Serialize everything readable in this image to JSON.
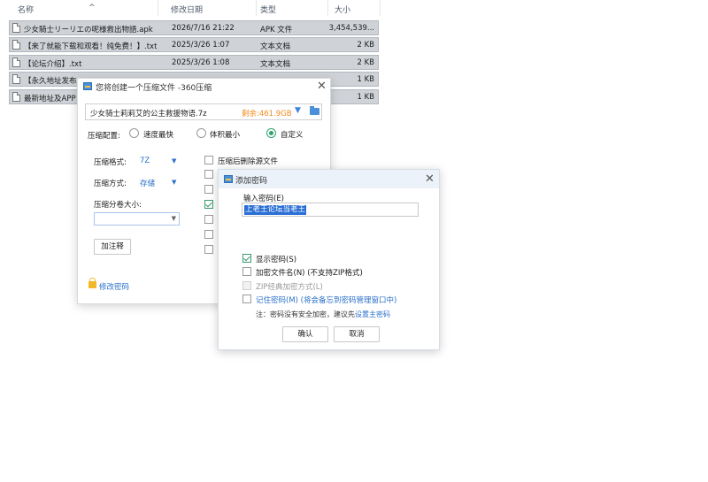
{
  "explorer": {
    "columns": {
      "name": "名称",
      "date": "修改日期",
      "type": "类型",
      "size": "大小"
    },
    "rows": [
      {
        "name": "少女騎士リーリエの呢様救出物語.apk",
        "date": "2026/7/16 21:22",
        "type": "APK 文件",
        "size": "3,454,539..."
      },
      {
        "name": "【来了就能下载和观看！纯免费！】.txt",
        "date": "2025/3/26 1:07",
        "type": "文本文档",
        "size": "2 KB"
      },
      {
        "name": "【论坛介绍】.txt",
        "date": "2025/3/26 1:08",
        "type": "文本文档",
        "size": "2 KB"
      },
      {
        "name": "【永久地址发布",
        "date": "",
        "type": "",
        "size": "1 KB"
      },
      {
        "name": "最新地址及APP",
        "date": "",
        "type": "",
        "size": "1 KB"
      }
    ]
  },
  "compress_dialog": {
    "title": "您将创建一个压缩文件 -360压缩",
    "close": "✕",
    "path": "少女骑士莉莉艾的公主救援物语.7z",
    "free_space": "剩余:461.9GB",
    "config_label": "压缩配置:",
    "radio_options": [
      "速度最快",
      "体积最小",
      "自定义"
    ],
    "format_label": "压缩格式:",
    "format_value": "7Z",
    "method_label": "压缩方式:",
    "method_value": "存储",
    "split_label": "压缩分卷大小:",
    "add_comment": "加注释",
    "delete_after": "压缩后删除源文件",
    "modify_password": "修改密码"
  },
  "password_dialog": {
    "title": "添加密码",
    "close": "✕",
    "input_label": "输入密码(E)",
    "password_value": "上老王论坛当老王",
    "show_password": "显示密码(S)",
    "encrypt_names": "加密文件名(N) (不支持ZIP格式)",
    "zip_classic": "ZIP经典加密方式(L)",
    "remember_password": "记住密码(M) (将会备忘到密码管理窗口中)",
    "note_text": "注：密码没有安全加密，建议先",
    "note_link": "设置主密码",
    "ok": "确认",
    "cancel": "取消"
  },
  "colors": {
    "accent": "#2a6fc9",
    "free_space": "#f28a1c",
    "selection": "#2b6fd6",
    "check_green": "#3a9a6e"
  }
}
